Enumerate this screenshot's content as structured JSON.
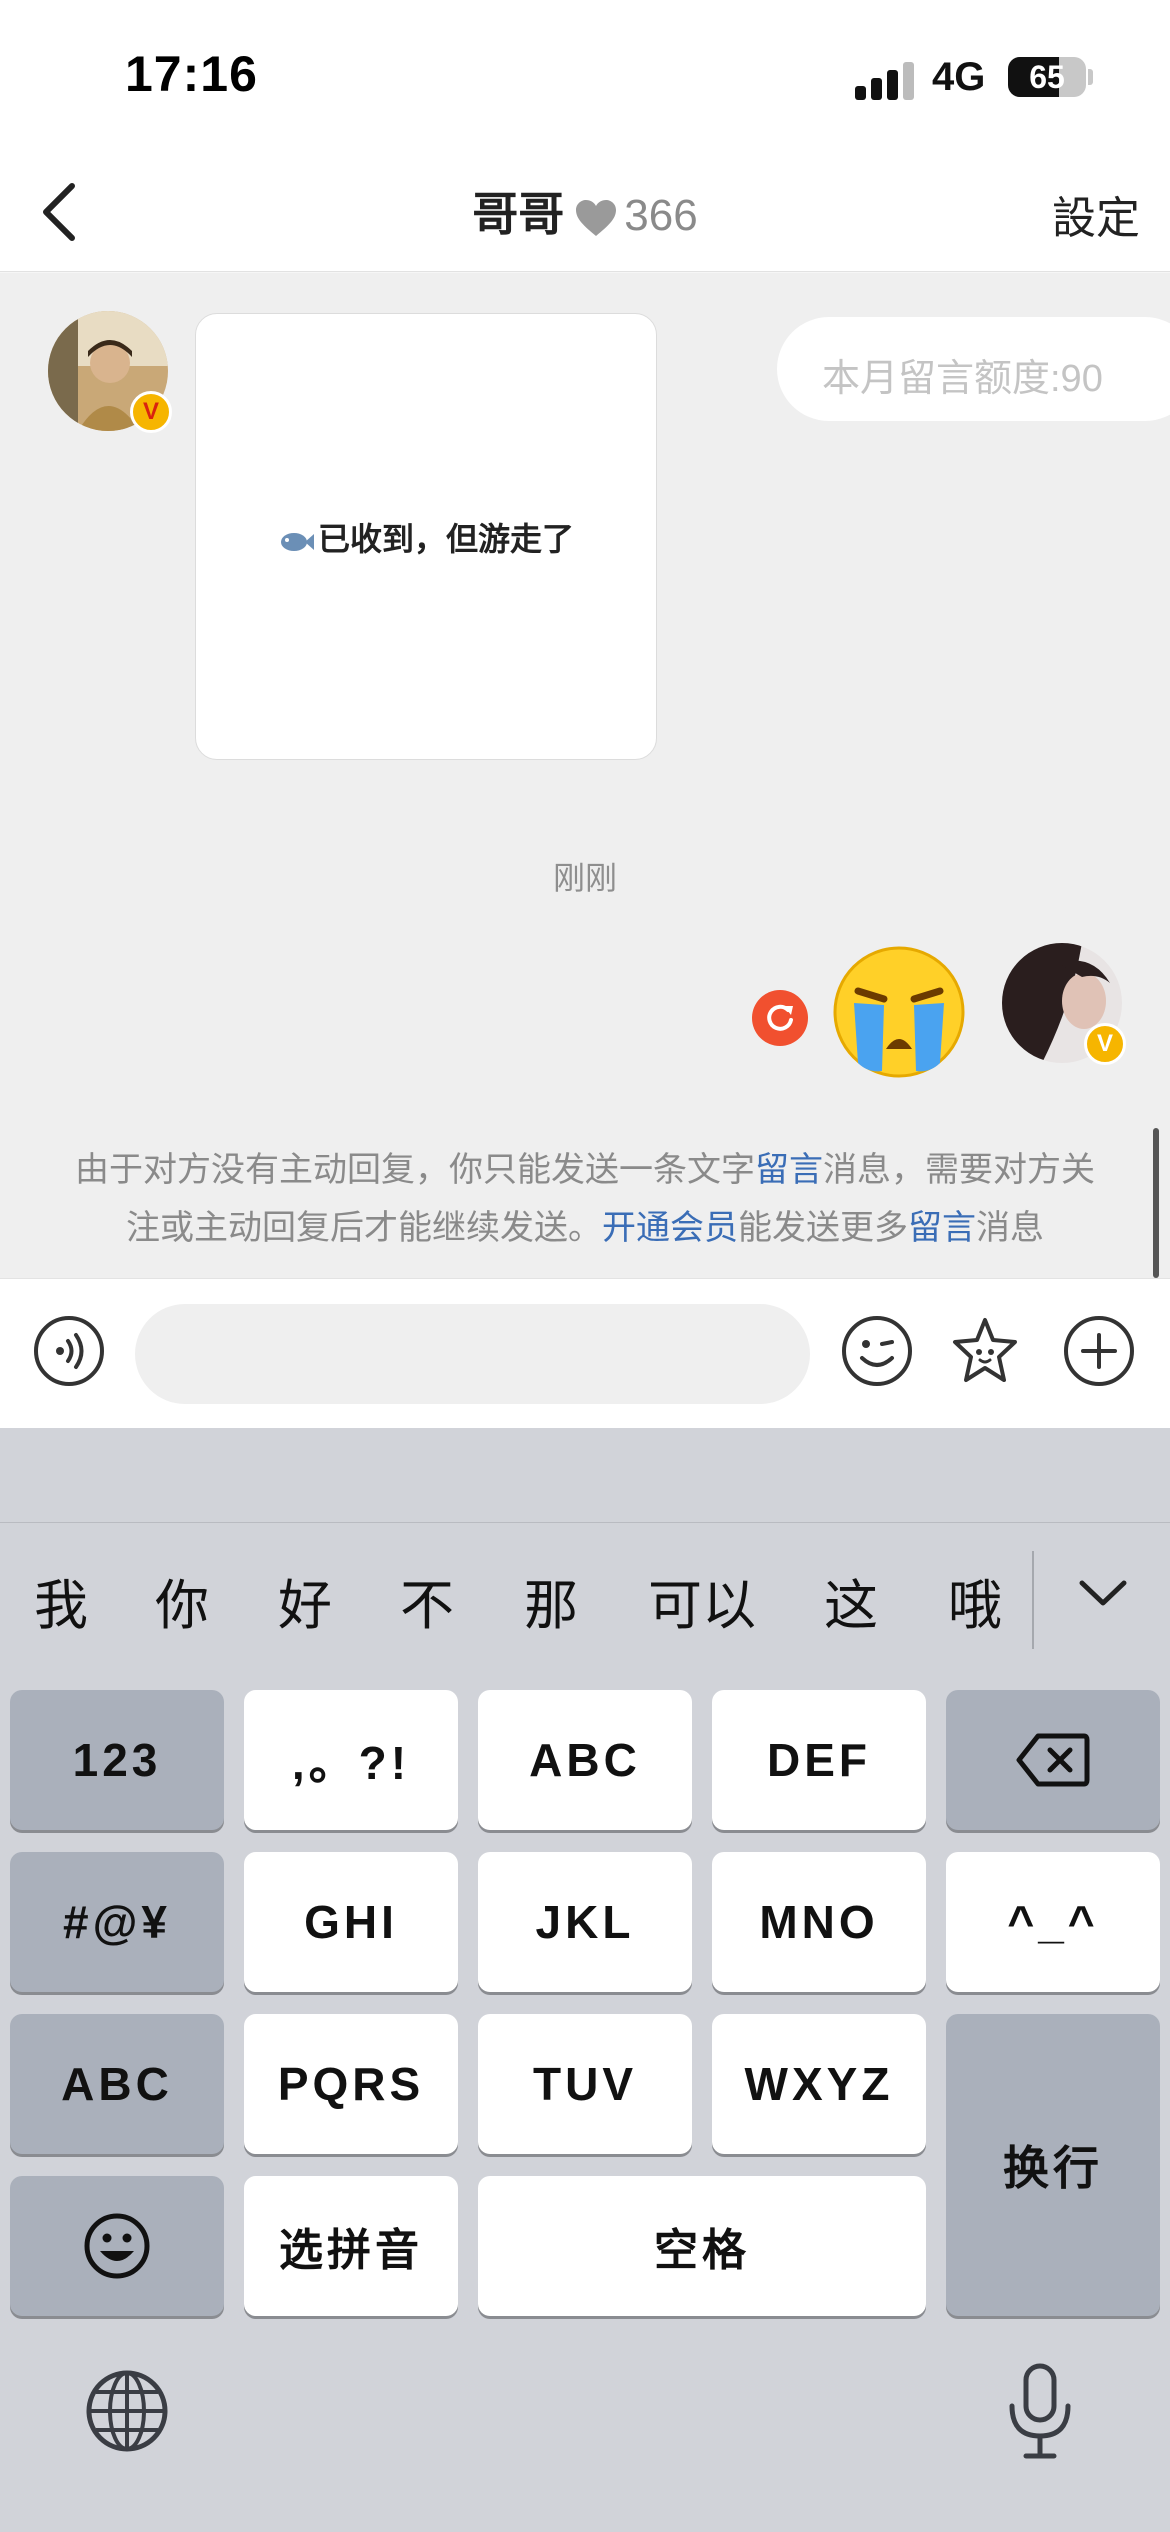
{
  "status_bar": {
    "time": "17:16",
    "network": "4G",
    "battery": "65",
    "battery_level": 0.65
  },
  "nav": {
    "title": "哥哥",
    "count": "366",
    "settings": "設定"
  },
  "chat": {
    "card_text": "已收到，但游走了",
    "quota": "本月留言额度:90",
    "timestamp": "刚刚",
    "notice": {
      "p1": "由于对方没有主动回复，你只能发送一条文字",
      "link1": "留言",
      "p2": "消息，需要对方关注或主动回复后才能继续发送。",
      "link2": "开通会员",
      "p3": "能发送更多",
      "link3": "留言",
      "p4": "消息"
    }
  },
  "keyboard": {
    "candidates": [
      "我",
      "你",
      "好",
      "不",
      "那",
      "可以",
      "这",
      "哦"
    ],
    "keys": {
      "num": "123",
      "punct": ",。?!",
      "abc1": "ABC",
      "def": "DEF",
      "symbols": "#@¥",
      "ghi": "GHI",
      "jkl": "JKL",
      "mno": "MNO",
      "emoticon": "^_^",
      "abc": "ABC",
      "pqrs": "PQRS",
      "tuv": "TUV",
      "wxyz": "WXYZ",
      "pinyin": "选拼音",
      "space": "空格",
      "enter": "换行"
    }
  },
  "colors": {
    "accent_link": "#3a6db6",
    "badge_red": "#f1502f",
    "badge_gold": "#f6b500"
  },
  "icons": [
    "back-icon",
    "heart-icon",
    "voice-icon",
    "emoji-icon",
    "star-sticker-icon",
    "plus-icon",
    "delete-icon",
    "globe-icon",
    "microphone-icon"
  ]
}
